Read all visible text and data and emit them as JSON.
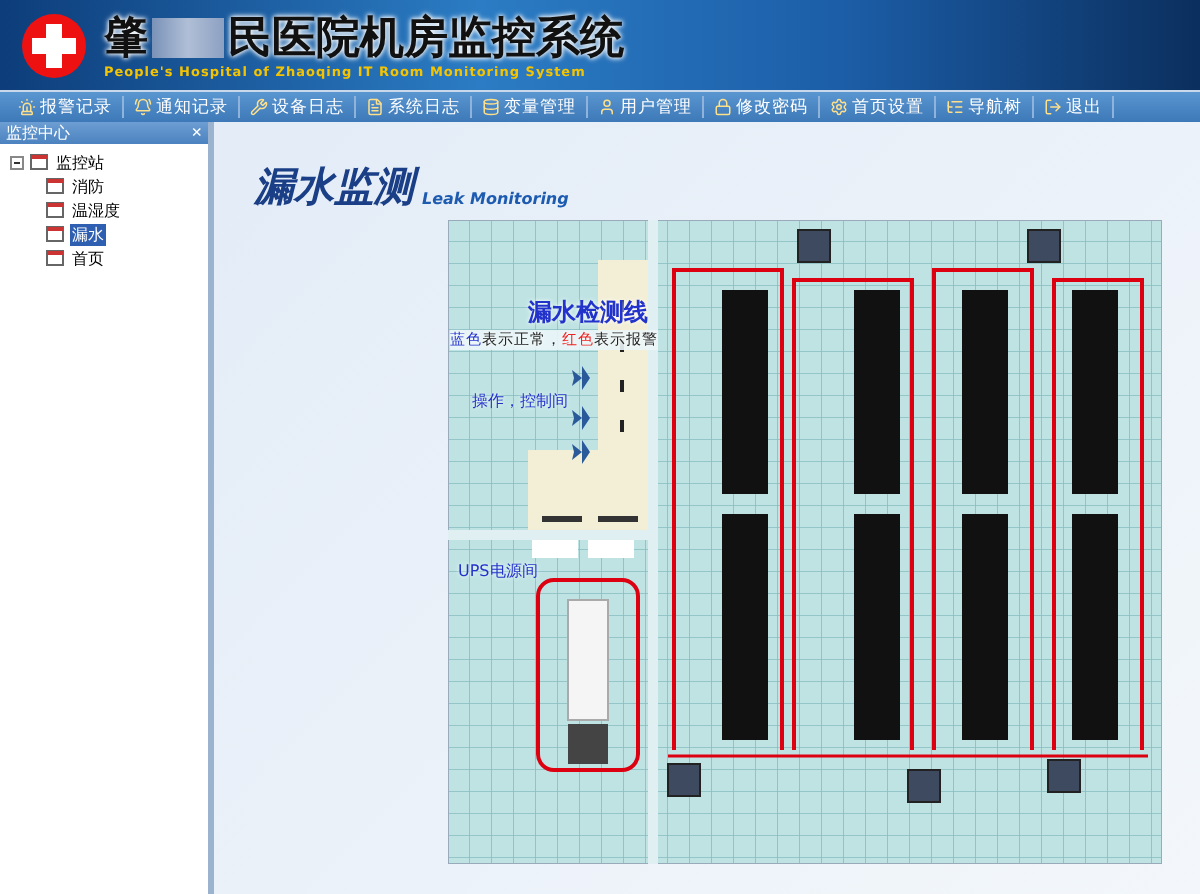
{
  "header": {
    "title_start": "肇",
    "title_end": "民医院机房监控系统",
    "subtitle": "People's Hospital of Zhaoqing IT Room Monitoring System"
  },
  "toolbar": [
    {
      "label": "报警记录",
      "kind": "alarm"
    },
    {
      "label": "通知记录",
      "kind": "notice"
    },
    {
      "label": "设备日志",
      "kind": "device"
    },
    {
      "label": "系统日志",
      "kind": "syslog"
    },
    {
      "label": "变量管理",
      "kind": "variable"
    },
    {
      "label": "用户管理",
      "kind": "user"
    },
    {
      "label": "修改密码",
      "kind": "password"
    },
    {
      "label": "首页设置",
      "kind": "settings"
    },
    {
      "label": "导航树",
      "kind": "tree"
    },
    {
      "label": "退出",
      "kind": "exit"
    }
  ],
  "sidebar": {
    "title": "监控中心",
    "close": "×",
    "tree": [
      {
        "label": "监控站",
        "expanded": true,
        "selected": false,
        "children": [
          {
            "label": "消防",
            "selected": false
          },
          {
            "label": "温湿度",
            "selected": false
          },
          {
            "label": "漏水",
            "selected": true
          },
          {
            "label": "首页",
            "selected": false
          }
        ]
      }
    ]
  },
  "main": {
    "title": "漏水监测",
    "subtitle": "Leak Monitoring",
    "floorplan": {
      "legend_title": "漏水检测线",
      "legend": [
        {
          "text": "蓝色",
          "color": "#2233cc"
        },
        {
          "text": "表示正常，"
        },
        {
          "text": "红色",
          "color": "#ee2222"
        },
        {
          "text": "表示报警"
        }
      ],
      "room_labels": [
        "操作，控制间",
        "UPS电源间"
      ]
    }
  }
}
